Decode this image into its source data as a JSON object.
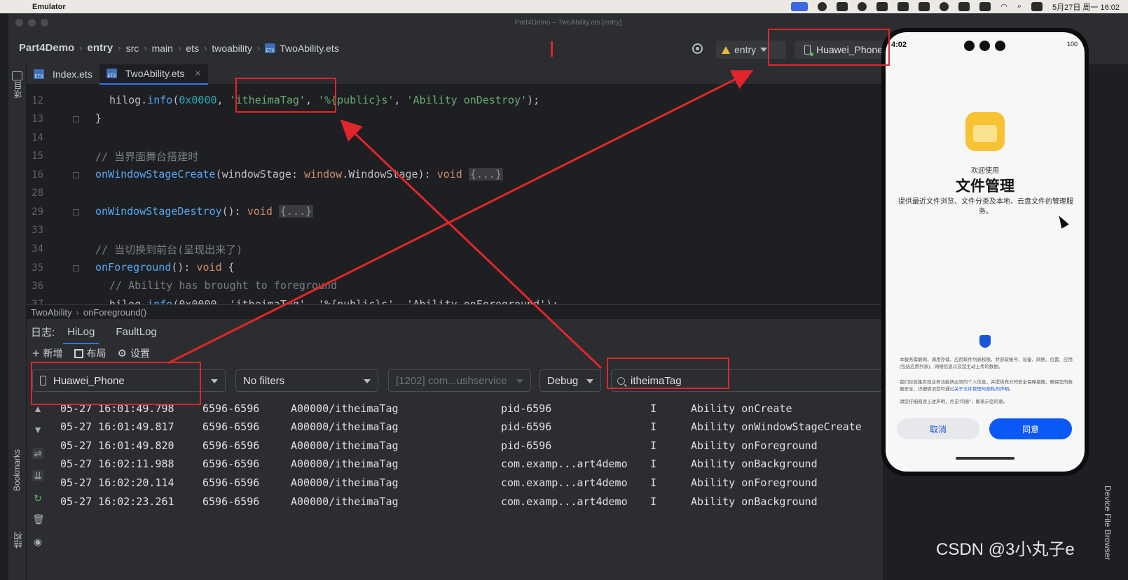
{
  "menubar": {
    "app_name": "Emulator",
    "datetime": "5月27日 周一  16:02"
  },
  "window": {
    "title": "Part4Demo – TwoAbility.ets [entry]"
  },
  "navbar": {
    "breadcrumb": [
      "Part4Demo",
      "entry",
      "src",
      "main",
      "ets",
      "twoability",
      "TwoAbility.ets"
    ],
    "run_config": "entry",
    "device": "Huawei_Phone"
  },
  "left_strip": {
    "project_label": "项目",
    "bookmarks_label": "Bookmarks",
    "structure_label": "结构"
  },
  "tabs": [
    {
      "label": "Index.ets"
    },
    {
      "label": "TwoAbility.ets"
    }
  ],
  "editor": {
    "lines": [
      {
        "no": "12"
      },
      {
        "no": "13"
      },
      {
        "no": "14"
      },
      {
        "no": "15"
      },
      {
        "no": "16"
      },
      {
        "no": "28"
      },
      {
        "no": "29"
      },
      {
        "no": "33"
      },
      {
        "no": "34"
      },
      {
        "no": "35"
      },
      {
        "no": "36"
      },
      {
        "no": "37"
      }
    ],
    "l12": {
      "fn": "hilog",
      "dot": ".",
      "method": "info",
      "open": "(",
      "num": "0x0000",
      "comma1": ", ",
      "tag": "'itheimaTag'",
      "comma2": ", ",
      "fmt": "'%{public}s'",
      "comma3": ", ",
      "msg": "'Ability onDestroy'",
      "close": ");"
    },
    "l13": "}",
    "l15": "// 当界面舞台搭建时",
    "l16": {
      "fn": "onWindowStageCreate",
      "p1": "(",
      "param": "windowStage",
      "p2": ": ",
      "type": "window",
      "p3": ".",
      "type2": "WindowStage",
      "p4": "): ",
      "kw": "void",
      "fold": "{...}"
    },
    "l29": {
      "fn": "onWindowStageDestroy",
      "p1": "(): ",
      "kw": "void",
      "fold": "{...}"
    },
    "l34": "// 当切换到前台(呈现出来了)",
    "l35": {
      "fn": "onForeground",
      "p1": "(): ",
      "kw": "void",
      "p2": " {"
    },
    "l36": "// Ability has brought to foreground",
    "l37": {
      "fn": "hilog",
      "dot": ".",
      "method": "info",
      "rest": "(0x0000, 'itheimaTag', '%{public}s', 'Ability onForeground');"
    }
  },
  "code_breadcrumb": [
    "TwoAbility",
    "onForeground()"
  ],
  "log": {
    "label": "日志:",
    "tabs": [
      "HiLog",
      "FaultLog"
    ],
    "tools": {
      "add": "新增",
      "layout": "布局",
      "settings": "设置"
    },
    "device_filter": "Huawei_Phone",
    "filter": "No filters",
    "process": "[1202] com...ushservice",
    "level": "Debug",
    "search_value": "itheimaTag",
    "rows": [
      {
        "time": "05-27 16:01:49.798",
        "pid": "6596-6596",
        "tag": "A00000/itheimaTag",
        "proc": "pid-6596",
        "lvl": "I",
        "msg": "Ability onCreate"
      },
      {
        "time": "05-27 16:01:49.817",
        "pid": "6596-6596",
        "tag": "A00000/itheimaTag",
        "proc": "pid-6596",
        "lvl": "I",
        "msg": "Ability onWindowStageCreate"
      },
      {
        "time": "05-27 16:01:49.820",
        "pid": "6596-6596",
        "tag": "A00000/itheimaTag",
        "proc": "pid-6596",
        "lvl": "I",
        "msg": "Ability onForeground"
      },
      {
        "time": "05-27 16:02:11.988",
        "pid": "6596-6596",
        "tag": "A00000/itheimaTag",
        "proc": "com.examp...art4demo",
        "lvl": "I",
        "msg": "Ability onBackground"
      },
      {
        "time": "05-27 16:02:20.114",
        "pid": "6596-6596",
        "tag": "A00000/itheimaTag",
        "proc": "com.examp...art4demo",
        "lvl": "I",
        "msg": "Ability onForeground"
      },
      {
        "time": "05-27 16:02:23.261",
        "pid": "6596-6596",
        "tag": "A00000/itheimaTag",
        "proc": "com.examp...art4demo",
        "lvl": "I",
        "msg": "Ability onBackground"
      }
    ]
  },
  "phone": {
    "time": "4:02",
    "battery": "100",
    "welcome": "欢迎使用",
    "title": "文件管理",
    "desc": "提供最近文件浏览、文件分类及本地、云盘文件的管理服务。",
    "para1": "本服务需联网，调用存储、应用软件列表权限，并获取帐号、设备、网络、位置、应用(包括应用列表)、网络信息以及您主动上传的数据。",
    "para2_a": "我们仅收集实现业务功能所必须的个人信息，并提供充分的安全保障措施，确保您的数据安全，详细情况您可通过",
    "para2_link": "关于文件管理与隐私的声明",
    "para2_b": "。",
    "para3": "请您仔细阅读上述声明，点击\"同意\"，即表示您同意。",
    "cancel": "取消",
    "agree": "同意"
  },
  "right_strip": {
    "label": "Device File Browser"
  },
  "watermark": "CSDN @3小丸子e",
  "annotation_color": "#e0262b"
}
